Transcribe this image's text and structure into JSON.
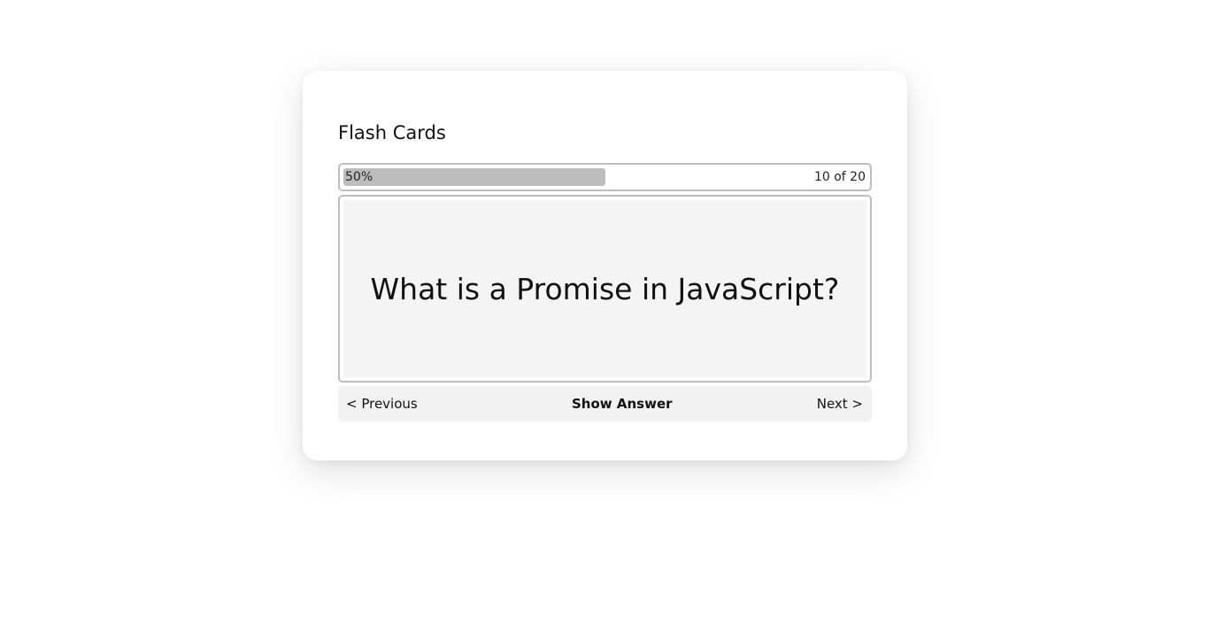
{
  "app": {
    "title": "Flash Cards"
  },
  "progress": {
    "percent_label": "50%",
    "fraction": 0.5,
    "count_label": "10 of 20"
  },
  "card": {
    "question": "What is a Promise in JavaScript?"
  },
  "controls": {
    "previous_label": "< Previous",
    "show_answer_label": "Show Answer",
    "next_label": "Next >"
  },
  "colors": {
    "progress_fill": "#bdbdbd",
    "card_face": "#f4f4f4",
    "nav_bar": "#f2f2f2"
  }
}
